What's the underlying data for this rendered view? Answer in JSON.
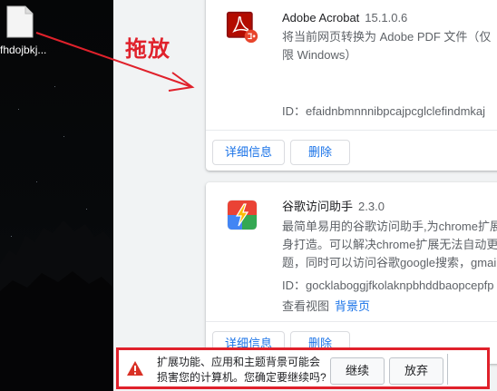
{
  "desktop": {
    "file_name": "fhdojbkj..."
  },
  "annotation": {
    "drag_label": "拖放",
    "color": "#e0212b"
  },
  "extensions": [
    {
      "name": "Adobe Acrobat",
      "version": "15.1.0.6",
      "description": "将当前网页转换为 Adobe PDF 文件（仅限 Windows）",
      "id_label": "ID：",
      "id": "efaidnbmnnnibpcajpcglclefindmkaj",
      "details_button": "详细信息",
      "remove_button": "删除",
      "icon": "adobe-acrobat-icon"
    },
    {
      "name": "谷歌访问助手",
      "version": "2.3.0",
      "description_lines": [
        "最简单易用的谷歌访问助手,为chrome扩展用",
        "身打造。可以解决chrome扩展无法自动更新",
        "题，同时可以访问谷歌google搜索，gmail邮"
      ],
      "id_label": "ID：",
      "id": "gocklaboggjfkolaknpbhddbaopcepfp",
      "views_label": "查看视图",
      "views_link": "背景页",
      "details_button": "详细信息",
      "remove_button": "删除",
      "icon": "google-helper-icon"
    }
  ],
  "install_warning": {
    "text": "扩展功能、应用和主题背景可能会损害您的计算机。您确定要继续吗?",
    "continue_button": "继续",
    "discard_button": "放弃",
    "icon": "warning-icon"
  }
}
